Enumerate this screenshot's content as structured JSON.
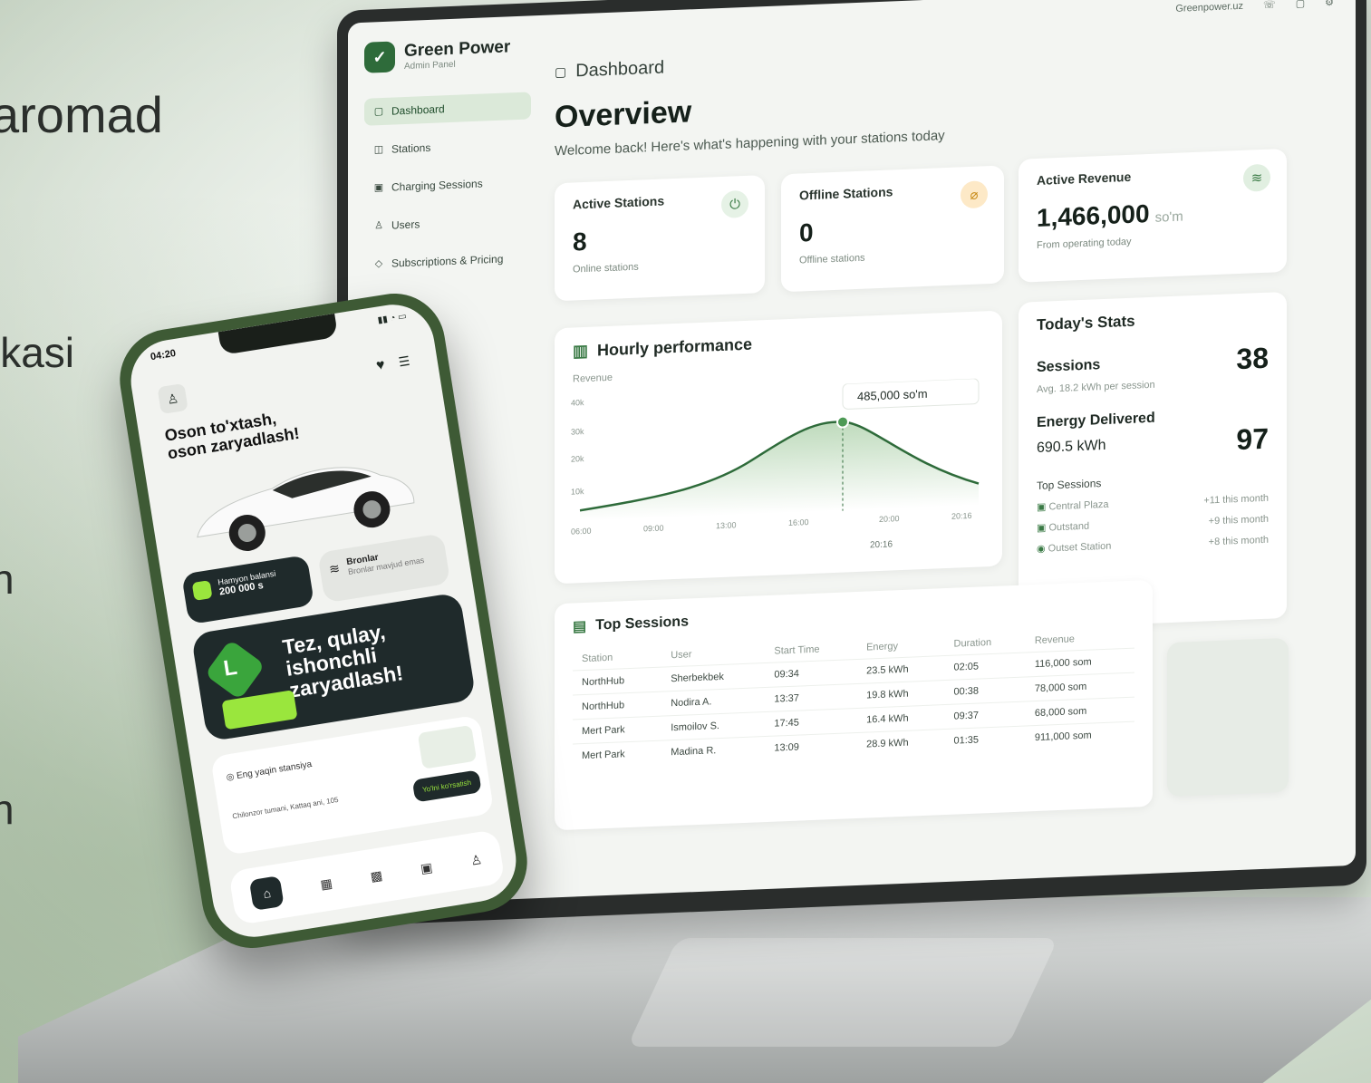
{
  "side_texts": [
    "aromad",
    "ikasi",
    "n",
    "h"
  ],
  "dashboard": {
    "brand_name": "Green Power",
    "brand_sub": "Admin Panel",
    "nav": [
      "Dashboard",
      "Stations",
      "Charging Sessions",
      "Users",
      "Subscriptions & Pricing"
    ],
    "topbar_user": "Greenpower.uz",
    "breadcrumb": "Dashboard",
    "title": "Overview",
    "subtitle": "Welcome back! Here's what's happening with your stations today",
    "kpis": [
      {
        "label": "Active Stations",
        "value": "8",
        "unit": "",
        "note": "Online stations",
        "icon": "power-icon",
        "color": "#e6f2e6"
      },
      {
        "label": "Offline Stations",
        "value": "0",
        "unit": "",
        "note": "Offline stations",
        "icon": "plug-off-icon",
        "color": "#fde9c7"
      },
      {
        "label": "Active Revenue",
        "value": "1,466,000",
        "unit": "so'm",
        "note": "From operating today",
        "icon": "coins-icon",
        "color": "#e1efe1"
      }
    ],
    "hourly": {
      "title": "Hourly performance",
      "series_label": "Revenue",
      "tooltip": "485,000 so'm",
      "y_ticks": [
        "40k",
        "30k",
        "20k",
        "10k"
      ],
      "x_ticks": [
        "06:00",
        "09:00",
        "13:00",
        "16:00",
        "20:00",
        "20:16"
      ],
      "footer": "20:16"
    },
    "today_stats": {
      "title": "Today's Stats",
      "sessions_label": "Sessions",
      "sessions_value": "38",
      "sessions_note": "Avg. 18.2 kWh per session",
      "energy_label": "Energy Delivered",
      "energy_value": "690.5 kWh",
      "energy_count": "97",
      "top_label": "Top Sessions",
      "top_items": [
        {
          "name": "Central Plaza",
          "value": "+11 this month"
        },
        {
          "name": "Outstand",
          "value": "+9 this month"
        },
        {
          "name": "Outset Station",
          "value": "+8 this month"
        }
      ]
    },
    "sessions_table": {
      "title": "Top Sessions",
      "columns": [
        "Station",
        "User",
        "Start Time",
        "Energy",
        "Duration",
        "Revenue"
      ],
      "rows": [
        [
          "NorthHub",
          "Sherbekbek",
          "09:34",
          "23.5 kWh",
          "02:05",
          "116,000 som"
        ],
        [
          "NorthHub",
          "Nodira A.",
          "13:37",
          "19.8 kWh",
          "00:38",
          "78,000 som"
        ],
        [
          "Mert Park",
          "Ismoilov S.",
          "17:45",
          "16.4 kWh",
          "09:37",
          "68,000 som"
        ],
        [
          "Mert Park",
          "Madina R.",
          "13:09",
          "28.9 kWh",
          "01:35",
          "911,000 som"
        ]
      ]
    }
  },
  "phone": {
    "time": "04:20",
    "headline": "Oson to'xtash,\noson zaryadlash!",
    "wallet_label": "Hamyon balansi",
    "wallet_value": "200 000 s",
    "booking_label": "Bronlar",
    "booking_note": "Bronlar mavjud emas",
    "promo": "Tez, qulay, ishonchli zaryadlash!",
    "promo_badge": "L",
    "nearest_label": "Eng yaqin stansiya",
    "nearest_address": "Chilonzor tumani, Kattaq ani, 105",
    "route_button": "Yo'lni ko'rsatish"
  }
}
